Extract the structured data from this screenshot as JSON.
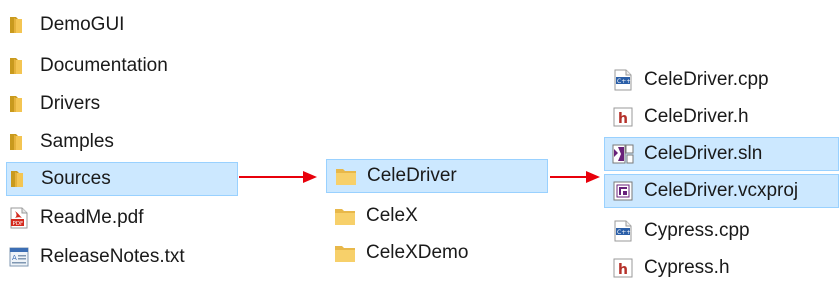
{
  "left_pane": {
    "items": [
      {
        "label": "DemoGUI",
        "icon": "folder-icon"
      },
      {
        "label": "Documentation",
        "icon": "folder-icon"
      },
      {
        "label": "Drivers",
        "icon": "folder-icon"
      },
      {
        "label": "Samples",
        "icon": "folder-icon"
      },
      {
        "label": "Sources",
        "icon": "folder-icon",
        "selected": true
      },
      {
        "label": "ReadMe.pdf",
        "icon": "pdf-file-icon"
      },
      {
        "label": "ReleaseNotes.txt",
        "icon": "text-file-icon"
      }
    ]
  },
  "middle_pane": {
    "items": [
      {
        "label": "CeleDriver",
        "icon": "folder-icon",
        "selected": true
      },
      {
        "label": "CeleX",
        "icon": "folder-icon"
      },
      {
        "label": "CeleXDemo",
        "icon": "folder-icon"
      }
    ]
  },
  "right_pane": {
    "items": [
      {
        "label": "CeleDriver.cpp",
        "icon": "cpp-file-icon"
      },
      {
        "label": "CeleDriver.h",
        "icon": "header-file-icon"
      },
      {
        "label": "CeleDriver.sln",
        "icon": "solution-file-icon",
        "selected": true
      },
      {
        "label": "CeleDriver.vcxproj",
        "icon": "vcxproj-file-icon",
        "selected": true
      },
      {
        "label": "Cypress.cpp",
        "icon": "cpp-file-icon"
      },
      {
        "label": "Cypress.h",
        "icon": "header-file-icon"
      }
    ]
  },
  "colors": {
    "selection_bg": "#cce8ff",
    "selection_border": "#99d1ff",
    "arrow": "#e8000b",
    "folder": "#f2c24f"
  }
}
